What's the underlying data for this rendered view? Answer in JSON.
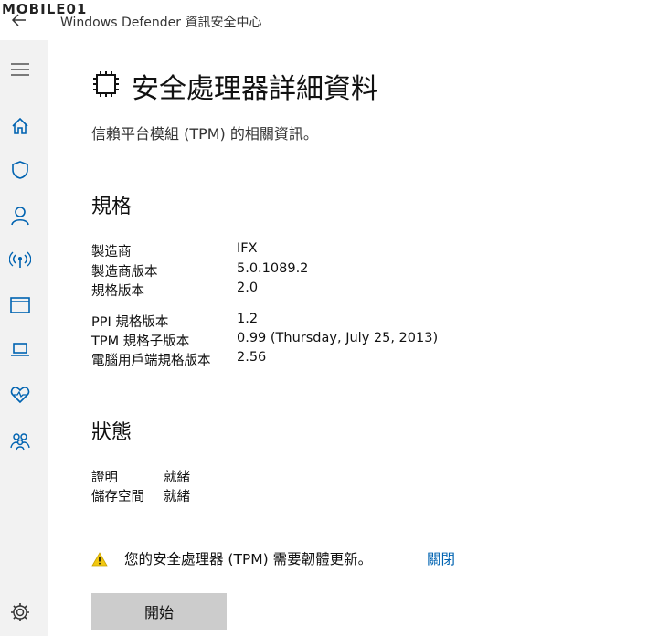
{
  "window": {
    "title": "Windows Defender 資訊安全中心",
    "watermark": "MOBILE01"
  },
  "page": {
    "title": "安全處理器詳細資料",
    "subtitle": "信賴平台模組 (TPM) 的相關資訊。"
  },
  "spec": {
    "heading": "規格",
    "rows": [
      {
        "label": "製造商",
        "value": "IFX"
      },
      {
        "label": "製造商版本",
        "value": "5.0.1089.2"
      },
      {
        "label": "規格版本",
        "value": "2.0"
      },
      {
        "label": "PPI 規格版本",
        "value": "1.2"
      },
      {
        "label": "TPM 規格子版本",
        "value": "0.99 (Thursday, July 25, 2013)"
      },
      {
        "label": "電腦用戶端規格版本",
        "value": "2.56"
      }
    ]
  },
  "status": {
    "heading": "狀態",
    "rows": [
      {
        "label": "證明",
        "value": "就緒"
      },
      {
        "label": "儲存空間",
        "value": "就緒"
      }
    ]
  },
  "warning": {
    "text": "您的安全處理器 (TPM) 需要韌體更新。",
    "link": "關閉",
    "icon": "warning-icon"
  },
  "actions": {
    "start": "開始"
  },
  "sidebar": {
    "icons": [
      "hamburger-icon",
      "home-icon",
      "shield-icon",
      "person-icon",
      "wireless-icon",
      "app-window-icon",
      "laptop-icon",
      "heart-icon",
      "family-icon",
      "gear-icon"
    ]
  },
  "colors": {
    "accent": "#0063b1",
    "warning": "#f2c811",
    "sidebar": "#f2f2f2",
    "button": "#cccccc"
  }
}
